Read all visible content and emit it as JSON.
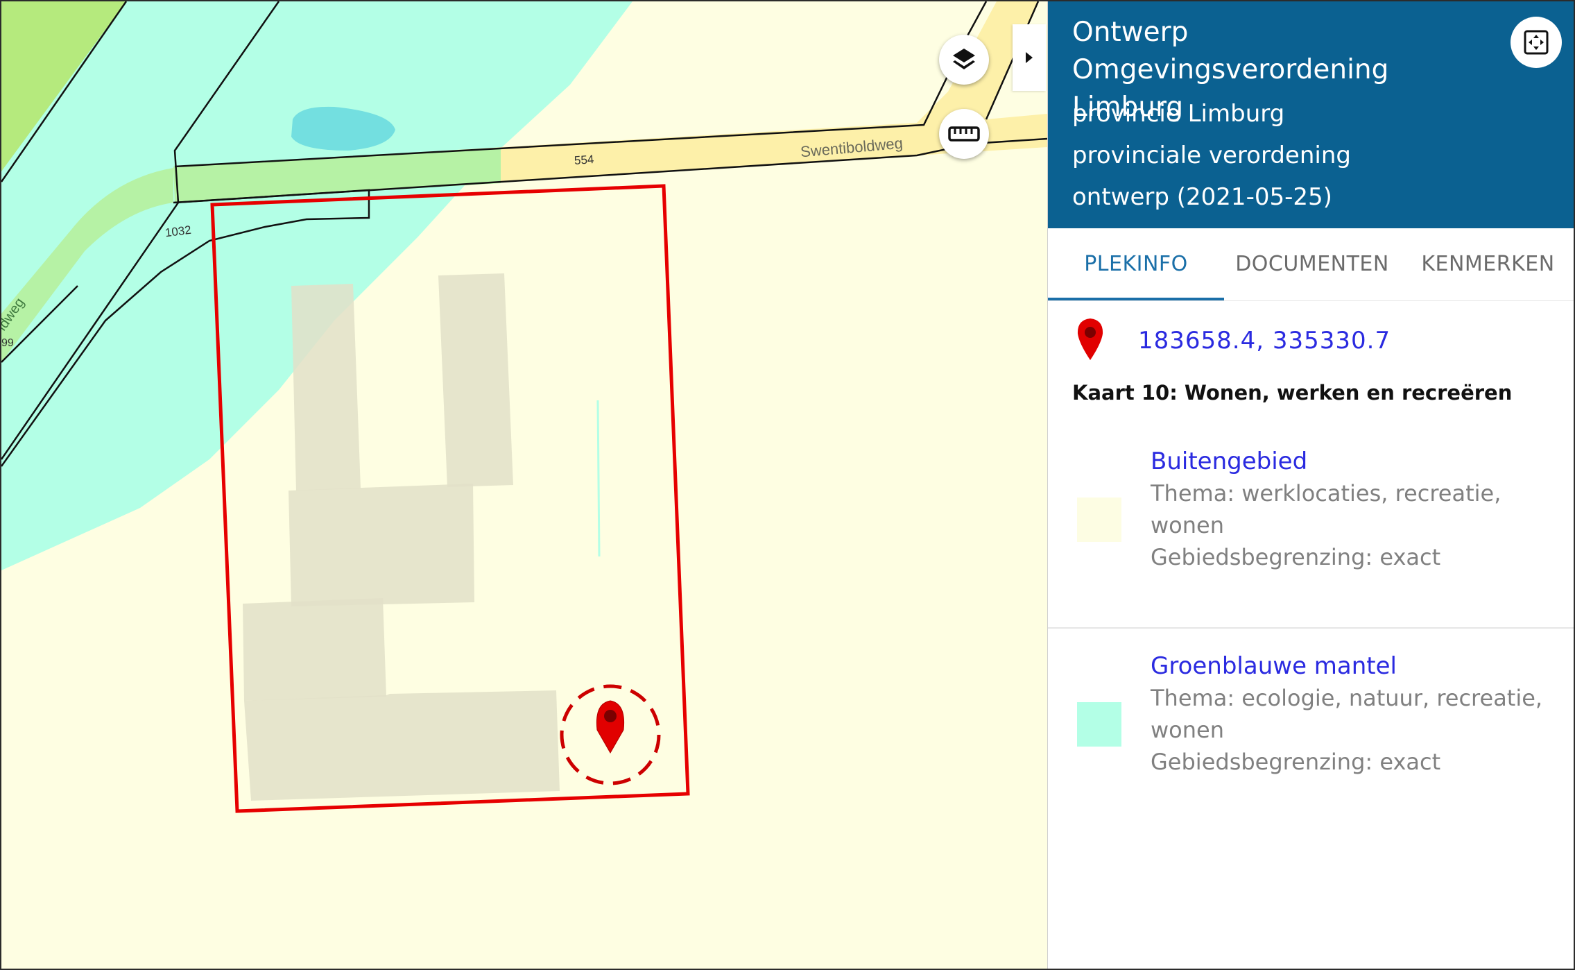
{
  "map": {
    "labels": {
      "street": "Swentiboldweg",
      "parcel_554": "554",
      "parcel_1032": "1032",
      "side_road": "ldweg",
      "side_number": "99"
    },
    "colors": {
      "background": "#fefee2",
      "groenblauwe_mantel": "#b3ffe6",
      "road": "#fdf0a9",
      "road_green": "#b6f2a5",
      "grass": "#b5ea7d",
      "water": "#73dfe0",
      "buildings": "#e7e5d2",
      "selection": "#e00000"
    },
    "buttons": {
      "layers_icon": "layers-icon",
      "measure_icon": "ruler-icon",
      "collapse_icon": "caret-right-icon"
    }
  },
  "panel": {
    "title": "Ontwerp Omgevingsverordening Limburg",
    "authority": "provincie Limburg",
    "type": "provinciale verordening",
    "status": "ontwerp (2021-05-25)",
    "header_color": "#0b6191",
    "fullscreen_icon": "fullscreen-icon",
    "tabs": [
      {
        "label": "PLEKINFO",
        "active": true
      },
      {
        "label": "DOCUMENTEN",
        "active": false
      },
      {
        "label": "KENMERKEN",
        "active": false
      }
    ],
    "coordinates": "183658.4, 335330.7",
    "kaart_title": "Kaart 10: Wonen, werken en recreëren",
    "legend": [
      {
        "name": "Buitengebied",
        "thema": "Thema: werklocaties, recreatie, wonen",
        "begrenzing": "Gebiedsbegrenzing: exact",
        "color": "#fdfde3"
      },
      {
        "name": "Groenblauwe mantel",
        "thema": "Thema: ecologie, natuur, recreatie, wonen",
        "begrenzing": "Gebiedsbegrenzing: exact",
        "color": "#b3ffe6"
      }
    ]
  }
}
